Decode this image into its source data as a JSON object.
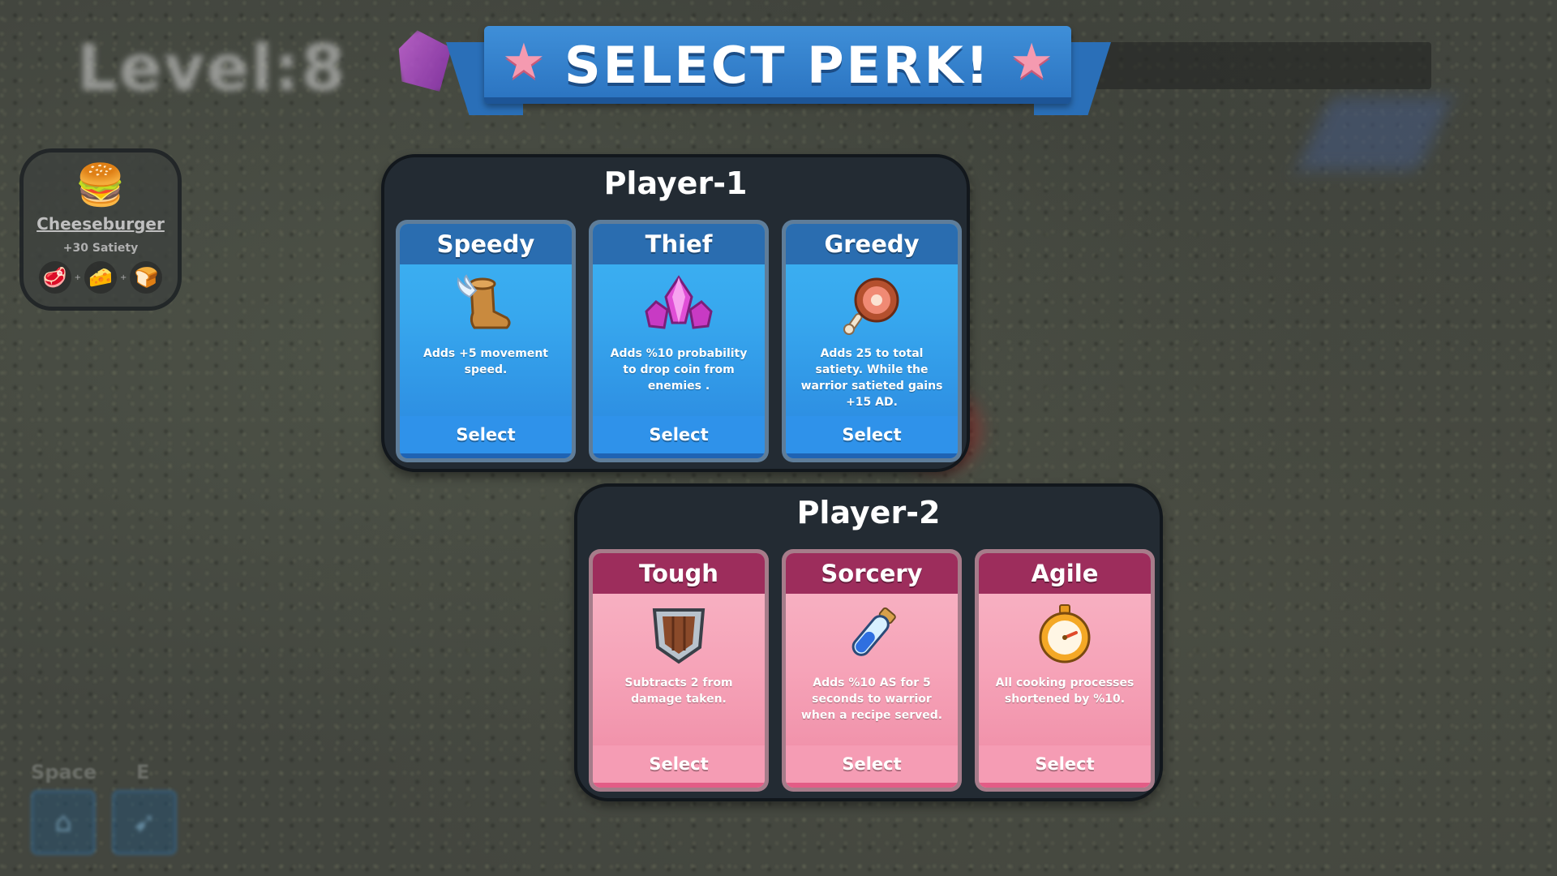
{
  "title": "SELECT PERK!",
  "hud": {
    "level_text": "Level:8",
    "recipe": {
      "name": "Cheeseburger",
      "bonus": "+30 Satiety"
    },
    "keys": [
      {
        "label": "Space",
        "icon": "jump-icon"
      },
      {
        "label": "E",
        "icon": "dash-icon"
      }
    ]
  },
  "players": [
    {
      "title": "Player-1",
      "theme": "#2f92ea",
      "perks": [
        {
          "name": "Speedy",
          "icon": "winged-boot-icon",
          "desc": "Adds +5 movement speed.",
          "button": "Select"
        },
        {
          "name": "Thief",
          "icon": "pink-crystals-icon",
          "desc": "Adds %10 probability to drop coin from enemies .",
          "button": "Select"
        },
        {
          "name": "Greedy",
          "icon": "meat-leg-icon",
          "desc": "Adds 25 to total satiety. While the warrior satieted gains +15 AD.",
          "button": "Select"
        }
      ]
    },
    {
      "title": "Player-2",
      "theme": "#f59cb4",
      "perks": [
        {
          "name": "Tough",
          "icon": "shield-icon",
          "desc": "Subtracts 2 from damage taken.",
          "button": "Select"
        },
        {
          "name": "Sorcery",
          "icon": "potion-icon",
          "desc": "Adds %10 AS for 5 seconds to warrior  when a recipe served.",
          "button": "Select"
        },
        {
          "name": "Agile",
          "icon": "stopwatch-icon",
          "desc": "All cooking processes shortened by %10.",
          "button": "Select"
        }
      ]
    }
  ]
}
